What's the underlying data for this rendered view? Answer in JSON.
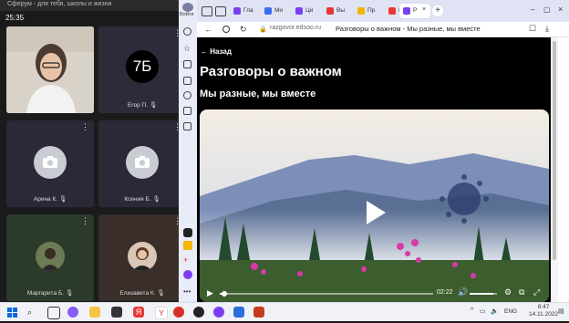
{
  "call_app": {
    "window_title": "Сферум - для тебя, школы и жизни",
    "elapsed_time": "25:35",
    "participants": [
      {
        "name": "",
        "video": true
      },
      {
        "name": "Егор П.",
        "initials": "7Б"
      },
      {
        "name": "Арина К.",
        "camera_off": true
      },
      {
        "name": "Ксения Б.",
        "camera_off": true
      },
      {
        "name": "Маргарита Б.",
        "avatar": true
      },
      {
        "name": "Елизавета К.",
        "avatar": true
      }
    ]
  },
  "browser": {
    "profile_label": "Войти",
    "tabs": [
      {
        "label": "Гла",
        "color": "#7b3ff2"
      },
      {
        "label": "Ми",
        "color": "#3a6cf2"
      },
      {
        "label": "Ци",
        "color": "#7b3ff2"
      },
      {
        "label": "Вы",
        "color": "#e53935"
      },
      {
        "label": "Пр",
        "color": "#f4b400"
      },
      {
        "label": "Ко",
        "color": "#e53935"
      },
      {
        "label": "Р",
        "color": "#7b3ff2",
        "active": true
      }
    ],
    "url": "razgovor.edsoo.ru",
    "page_title_tab": "Разговоры о важном - Мы разные, мы вместе"
  },
  "page": {
    "back_label": "← Назад",
    "title": "Разговоры о важном",
    "subtitle": "Мы разные, мы вместе",
    "video": {
      "current_time": "02:22",
      "progress": 0.02,
      "volume": 0.85
    }
  },
  "taskbar": {
    "lang": "ENG",
    "time": "8:47",
    "date": "14.11.2022",
    "colors": {
      "yandex": "#e53935",
      "sferum": "#7b3ff2"
    }
  }
}
